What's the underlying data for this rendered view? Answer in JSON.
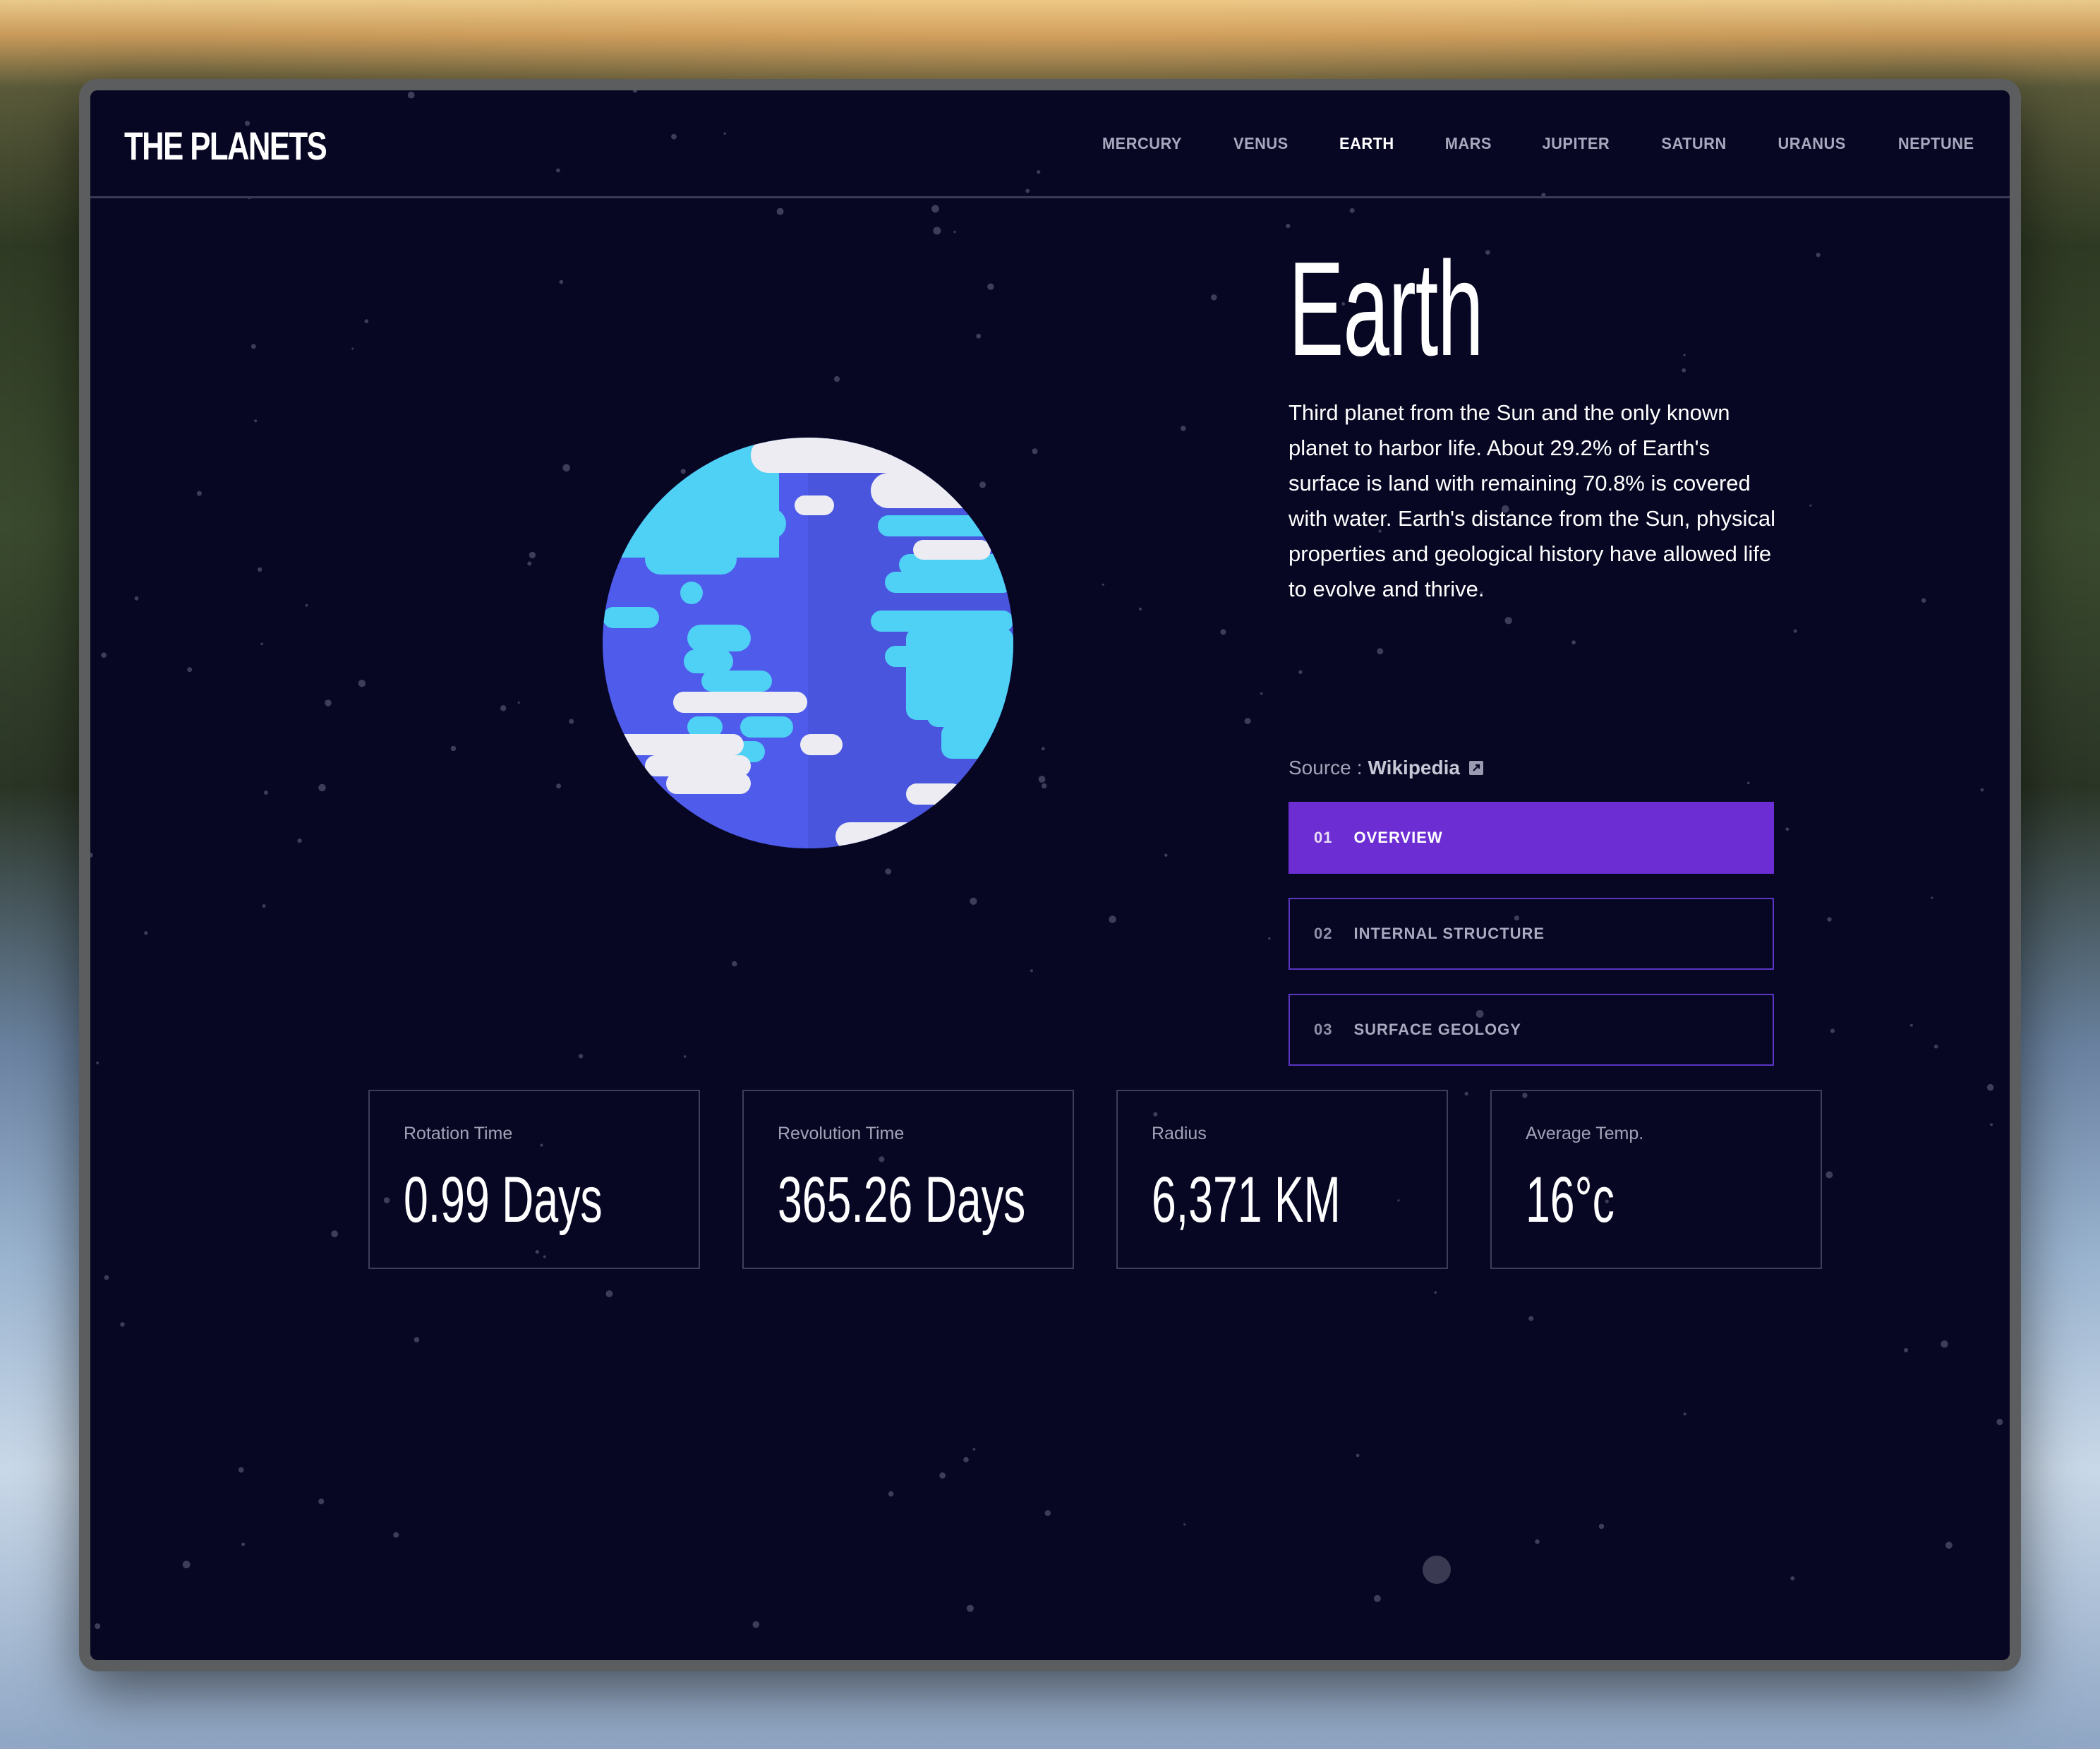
{
  "app": {
    "logo": "THE PLANETS"
  },
  "nav": {
    "items": [
      "MERCURY",
      "VENUS",
      "EARTH",
      "MARS",
      "JUPITER",
      "SATURN",
      "URANUS",
      "NEPTUNE"
    ],
    "active": "EARTH"
  },
  "planet": {
    "name": "Earth",
    "description": "Third planet from the Sun and the only known planet to harbor life. About 29.2% of Earth's surface is land with remaining 70.8% is covered with water. Earth's distance from the Sun, physical properties and geological history have allowed life to evolve and thrive.",
    "source_label": "Source",
    "source_link": "Wikipedia"
  },
  "tabs": [
    {
      "num": "01",
      "label": "OVERVIEW",
      "active": true
    },
    {
      "num": "02",
      "label": "INTERNAL STRUCTURE",
      "active": false
    },
    {
      "num": "03",
      "label": "SURFACE GEOLOGY",
      "active": false
    }
  ],
  "stats": [
    {
      "label": "Rotation Time",
      "value": "0.99 Days"
    },
    {
      "label": "Revolution Time",
      "value": "365.26 Days"
    },
    {
      "label": "Radius",
      "value": "6,371 KM"
    },
    {
      "label": "Average Temp.",
      "value": "16°c"
    }
  ],
  "colors": {
    "background": "#070724",
    "accent": "#6c2ed3",
    "ocean": "#4f5bea",
    "land": "#4fd0f5",
    "cloud": "#ececf2"
  },
  "icons": [
    "external-link-icon",
    "earth-planet-icon"
  ]
}
